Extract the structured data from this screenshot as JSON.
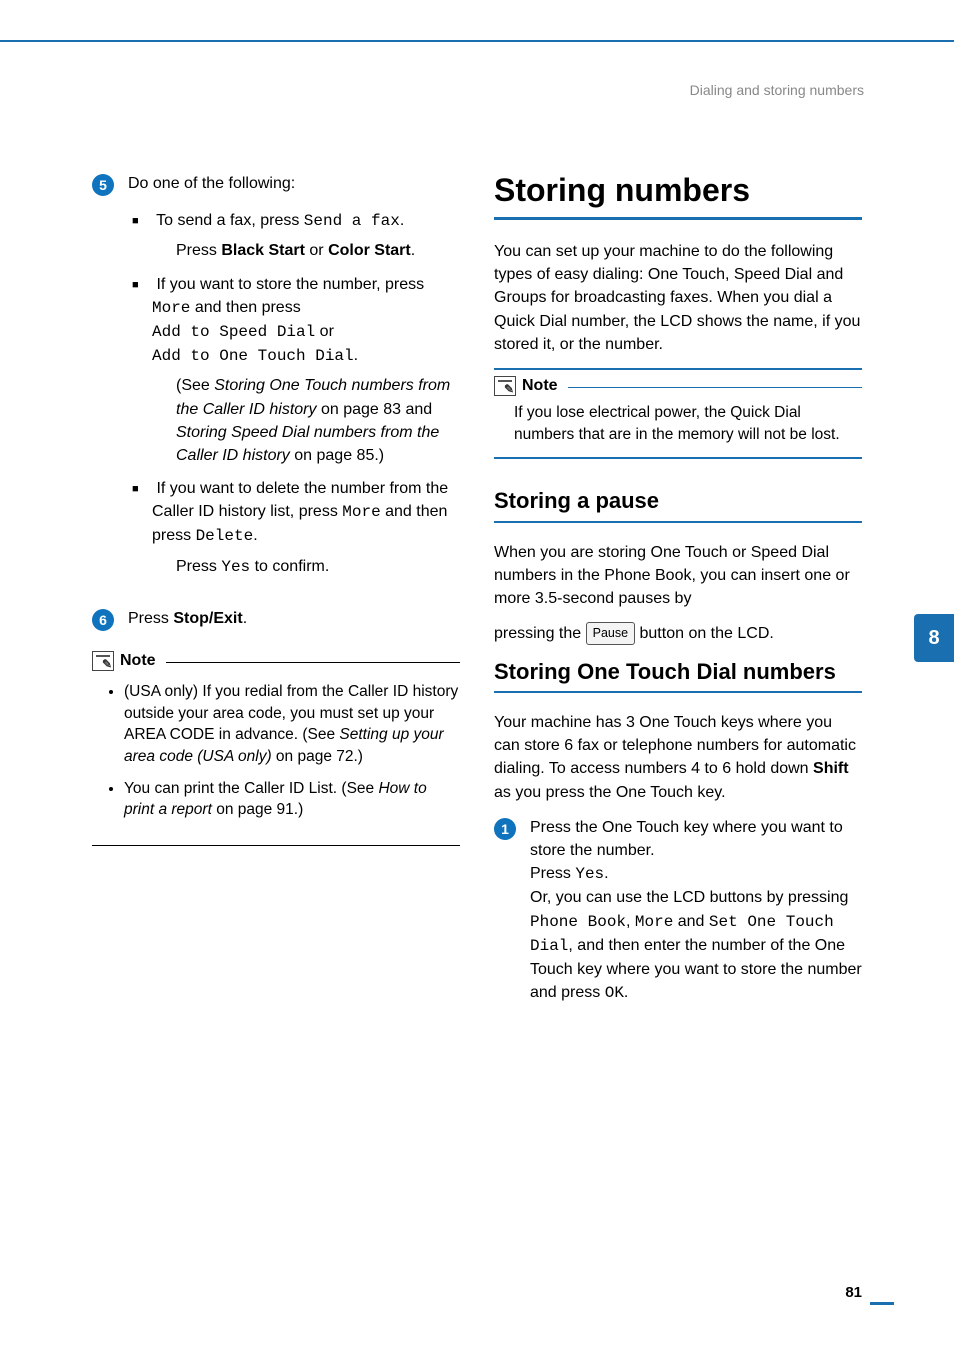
{
  "header": {
    "section": "Dialing and storing numbers"
  },
  "left": {
    "step5": {
      "num": "5",
      "lead": "Do one of the following:",
      "b1a": "To send a fax, press ",
      "b1b": "Send a fax",
      "b1c": ".",
      "b1d_a": "Press ",
      "b1d_b": "Black Start",
      "b1d_c": " or ",
      "b1d_d": "Color Start",
      "b1d_e": ".",
      "b2a": "If you want to store the number, press ",
      "b2b": "More",
      "b2c": " and then press ",
      "b2d": "Add to Speed Dial",
      "b2e": " or ",
      "b2f": "Add to One Touch Dial",
      "b2g": ".",
      "b2h_a": "(See ",
      "b2h_b": "Storing One Touch numbers from the Caller ID history",
      "b2h_c": " on page 83 and ",
      "b2h_d": "Storing Speed Dial numbers from the Caller ID history",
      "b2h_e": " on page 85.)",
      "b3a": "If you want to delete the number from the Caller ID history list, press ",
      "b3b": "More",
      "b3c": " and then press ",
      "b3d": "Delete",
      "b3e": ".",
      "b3f_a": "Press ",
      "b3f_b": "Yes",
      "b3f_c": " to confirm."
    },
    "step6": {
      "num": "6",
      "a": "Press ",
      "b": "Stop/Exit",
      "c": "."
    },
    "note": {
      "title": "Note",
      "li1a": "(USA only) If you redial from the Caller ID history outside your area code, you must set up your AREA CODE in advance. (See ",
      "li1b": "Setting up your area code (USA only)",
      "li1c": " on page 72.)",
      "li2a": "You can print the Caller ID List. (See ",
      "li2b": "How to print a report",
      "li2c": " on page 91.)"
    }
  },
  "right": {
    "h1": "Storing numbers",
    "intro": "You can set up your machine to do the following types of easy dialing: One Touch, Speed Dial and Groups for broadcasting faxes. When you dial a Quick Dial number, the LCD shows the name, if you stored it, or the number.",
    "note": {
      "title": "Note",
      "body": "If you lose electrical power, the Quick Dial numbers that are in the memory will not be lost."
    },
    "h2a": "Storing a pause",
    "pausePara_a": "When you are storing One Touch or Speed Dial numbers in the Phone Book, you can insert one or more 3.5-second pauses by",
    "pausePara_b": "pressing the ",
    "pauseBtn": "Pause",
    "pausePara_c": " button on the LCD.",
    "h2b": "Storing One Touch Dial numbers",
    "otIntro_a": "Your machine has 3 One Touch keys where you can store 6 fax or telephone numbers for automatic dialing. To access numbers 4 to 6 hold down ",
    "otIntro_b": "Shift",
    "otIntro_c": " as you press the One Touch key.",
    "step1": {
      "num": "1",
      "l1": "Press the One Touch key where you want to store the number.",
      "l2a": "Press ",
      "l2b": "Yes",
      "l2c": ".",
      "l3a": "Or, you can use the LCD buttons by pressing ",
      "l3b": "Phone Book",
      "l3c": ", ",
      "l3d": "More",
      "l3e": " and ",
      "l3f": "Set One Touch Dial",
      "l3g": ", and then enter the number of the One Touch key where you want to store the number and press ",
      "l3h": "OK",
      "l3i": "."
    }
  },
  "tab": "8",
  "pagenum": "81"
}
